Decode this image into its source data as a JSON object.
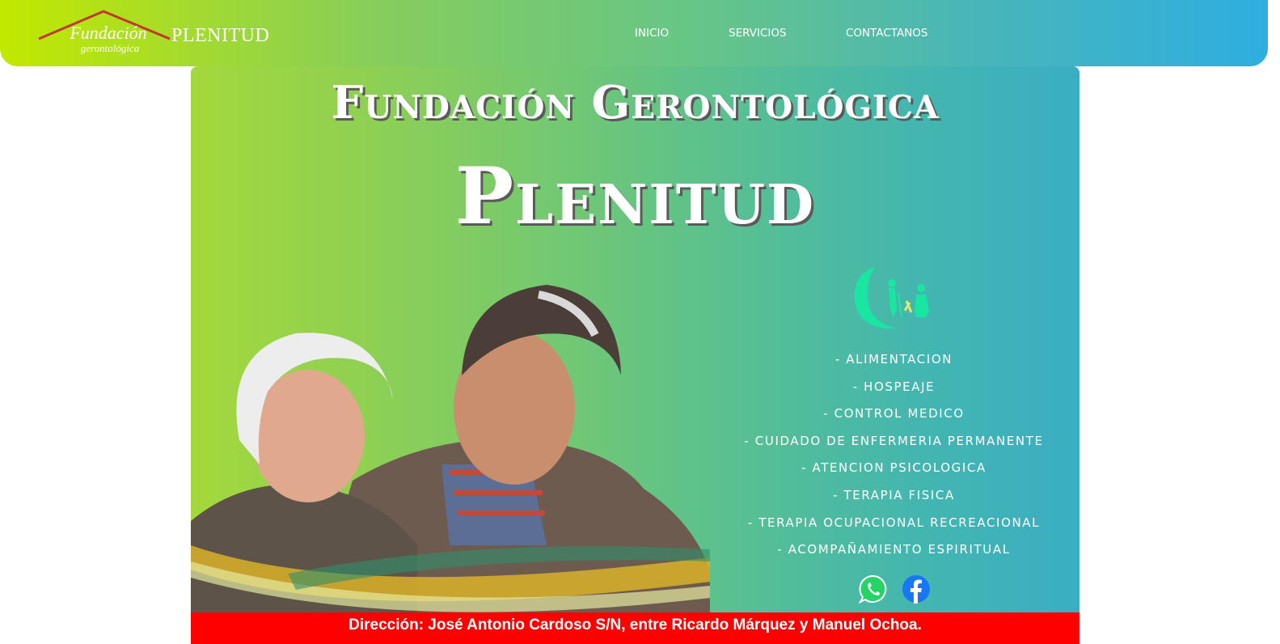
{
  "header": {
    "logo": {
      "script_line1": "Fundación",
      "script_line2": "gerontológica",
      "brand": "PLENITUD"
    },
    "nav": [
      {
        "label": "INICIO"
      },
      {
        "label": "SERVICIOS"
      },
      {
        "label": "CONTACTANOS"
      }
    ]
  },
  "hero": {
    "title_line1": "Fundación Gerontológica",
    "title_line2": "Plenitud",
    "services": [
      "- ALIMENTACION",
      "- HOSPEAJE",
      "- CONTROL MEDICO",
      "- CUIDADO DE ENFERMERIA PERMANENTE",
      "- ATENCION PSICOLOGICA",
      "- TERAPIA FISICA",
      "- TERAPIA OCUPACIONAL RECREACIONAL",
      "- ACOMPAÑAMIENTO ESPIRITUAL"
    ],
    "social": [
      {
        "icon": "whatsapp-icon",
        "color": "#25d366"
      },
      {
        "icon": "facebook-icon",
        "color": "#1877f2"
      }
    ]
  },
  "footer": {
    "address": "Dirección: José Antonio Cardoso S/N, entre Ricardo Márquez y Manuel Ochoa."
  },
  "colors": {
    "header_gradient": [
      "#c2e800",
      "#2eaee0"
    ],
    "hero_gradient": [
      "#a4d83c",
      "#3aaec4"
    ],
    "address_bar": "#fe0000",
    "logo_roof": "#c0392b"
  }
}
